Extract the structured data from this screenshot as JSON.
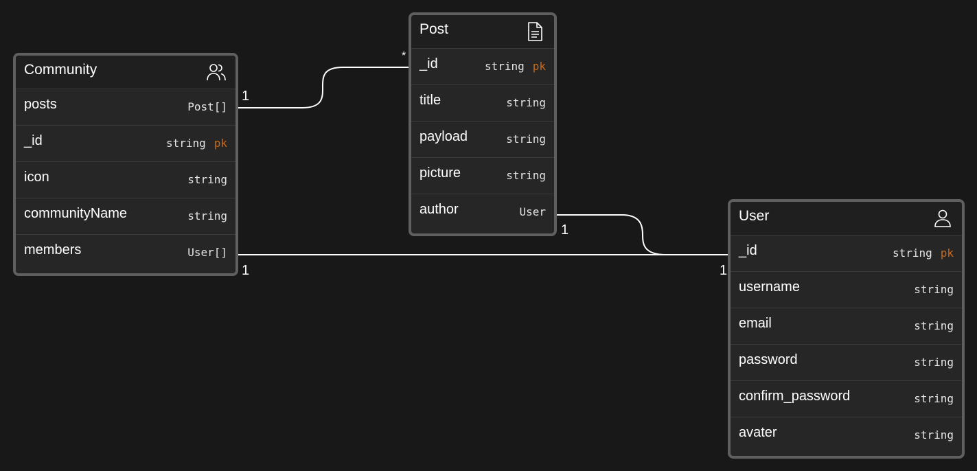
{
  "entities": {
    "community": {
      "title": "Community",
      "icon": "users-icon",
      "fields": [
        {
          "name": "posts",
          "type": "Post[]",
          "pk": ""
        },
        {
          "name": "_id",
          "type": "string",
          "pk": "pk"
        },
        {
          "name": "icon",
          "type": "string",
          "pk": ""
        },
        {
          "name": "communityName",
          "type": "string",
          "pk": ""
        },
        {
          "name": "members",
          "type": "User[]",
          "pk": ""
        }
      ]
    },
    "post": {
      "title": "Post",
      "icon": "document-icon",
      "fields": [
        {
          "name": "_id",
          "type": "string",
          "pk": "pk"
        },
        {
          "name": "title",
          "type": "string",
          "pk": ""
        },
        {
          "name": "payload",
          "type": "string",
          "pk": ""
        },
        {
          "name": "picture",
          "type": "string",
          "pk": ""
        },
        {
          "name": "author",
          "type": "User",
          "pk": ""
        }
      ]
    },
    "user": {
      "title": "User",
      "icon": "user-icon",
      "fields": [
        {
          "name": "_id",
          "type": "string",
          "pk": "pk"
        },
        {
          "name": "username",
          "type": "string",
          "pk": ""
        },
        {
          "name": "email",
          "type": "string",
          "pk": ""
        },
        {
          "name": "password",
          "type": "string",
          "pk": ""
        },
        {
          "name": "confirm_password",
          "type": "string",
          "pk": ""
        },
        {
          "name": "avater",
          "type": "string",
          "pk": ""
        }
      ]
    }
  },
  "relations": [
    {
      "from": "Community.posts",
      "to": "Post._id",
      "from_card": "1",
      "to_card": "*"
    },
    {
      "from": "Community.members",
      "to": "User._id",
      "from_card": "1",
      "to_card": "1"
    },
    {
      "from": "Post.author",
      "to": "User._id",
      "from_card": "1",
      "to_card": "*"
    }
  ],
  "colors": {
    "background": "#181818",
    "card": "#262626",
    "header": "#1f1f1f",
    "border": "#5f5f5f",
    "pk": "#c96a1b",
    "connector": "#ffffff"
  }
}
